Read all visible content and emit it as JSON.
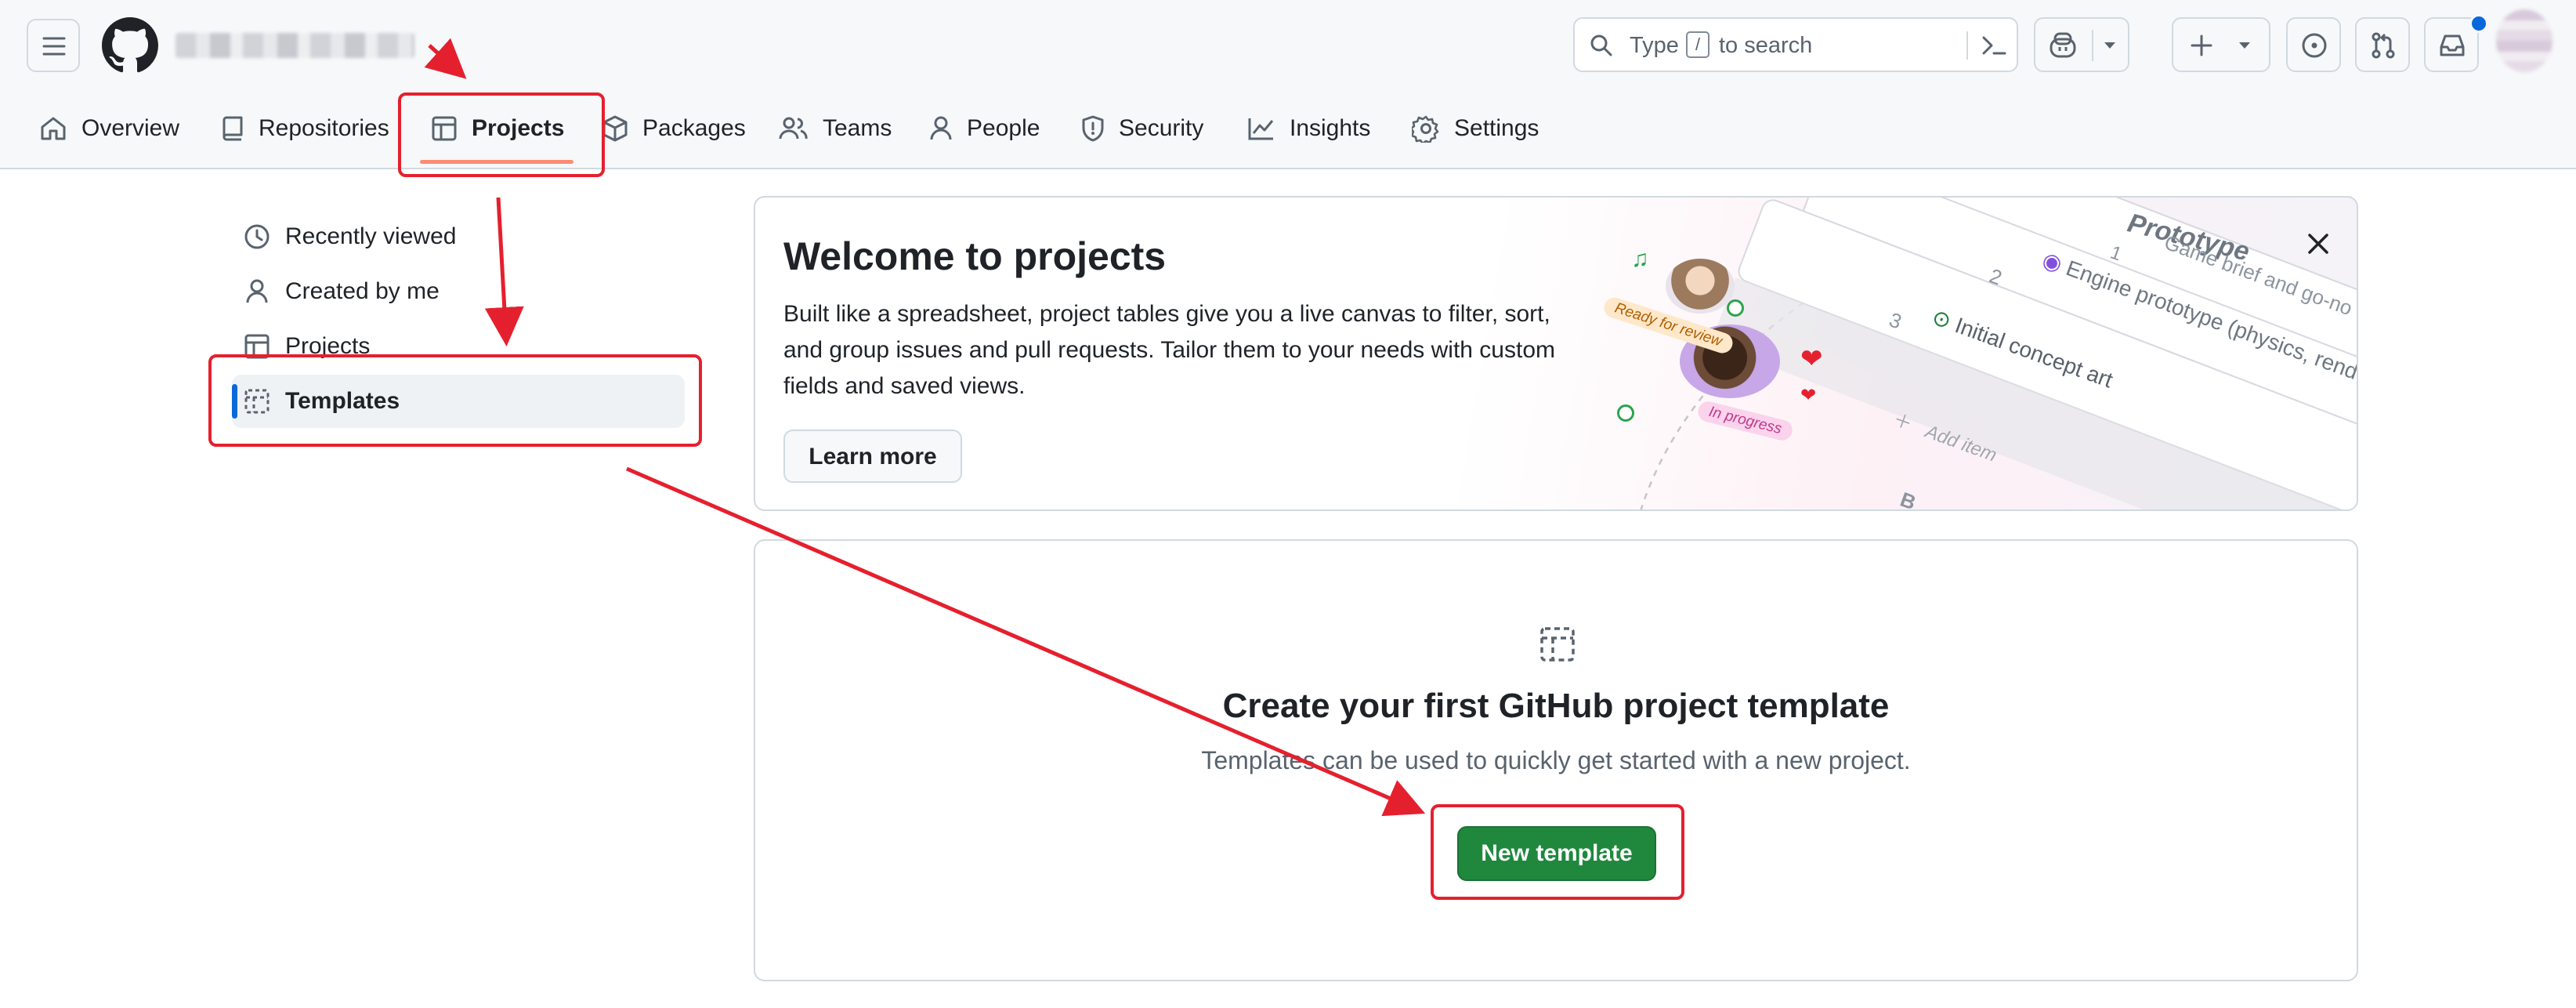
{
  "header": {
    "org_name": "████ ███ ████",
    "search": {
      "pre": "Type",
      "key": "/",
      "post": "to search"
    }
  },
  "tabs": [
    {
      "label": "Overview"
    },
    {
      "label": "Repositories"
    },
    {
      "label": "Projects"
    },
    {
      "label": "Packages"
    },
    {
      "label": "Teams"
    },
    {
      "label": "People"
    },
    {
      "label": "Security"
    },
    {
      "label": "Insights"
    },
    {
      "label": "Settings"
    }
  ],
  "sidebar": {
    "items": [
      {
        "label": "Recently viewed"
      },
      {
        "label": "Created by me"
      },
      {
        "label": "Projects"
      },
      {
        "label": "Templates"
      }
    ]
  },
  "banner": {
    "title": "Welcome to projects",
    "desc_line1": "Built like a spreadsheet, project tables give you a live canvas to filter, sort,",
    "desc_line2": "and group issues and pull requests. Tailor them to your needs with custom",
    "desc_line3": "fields and saved views.",
    "learn_more": "Learn more",
    "illustration": {
      "prototype": "Prototype",
      "row1_num": "1",
      "row1_text": "Game brief and go-no",
      "row2_num": "2",
      "row2_text": "Engine prototype (physics, renderin",
      "row3_num": "3",
      "row3_text": "Initial concept art",
      "add_item": "Add item",
      "badge_ready": "Ready for review",
      "badge_progress": "In progress",
      "b_label": "B"
    }
  },
  "empty_state": {
    "title": "Create your first GitHub project template",
    "subtitle": "Templates can be used to quickly get started with a new project.",
    "button": "New template"
  },
  "colors": {
    "accent": "#fd8c73",
    "primary_button": "#1f883d",
    "annotation": "#e5202e",
    "selected_bar": "#0969da"
  }
}
